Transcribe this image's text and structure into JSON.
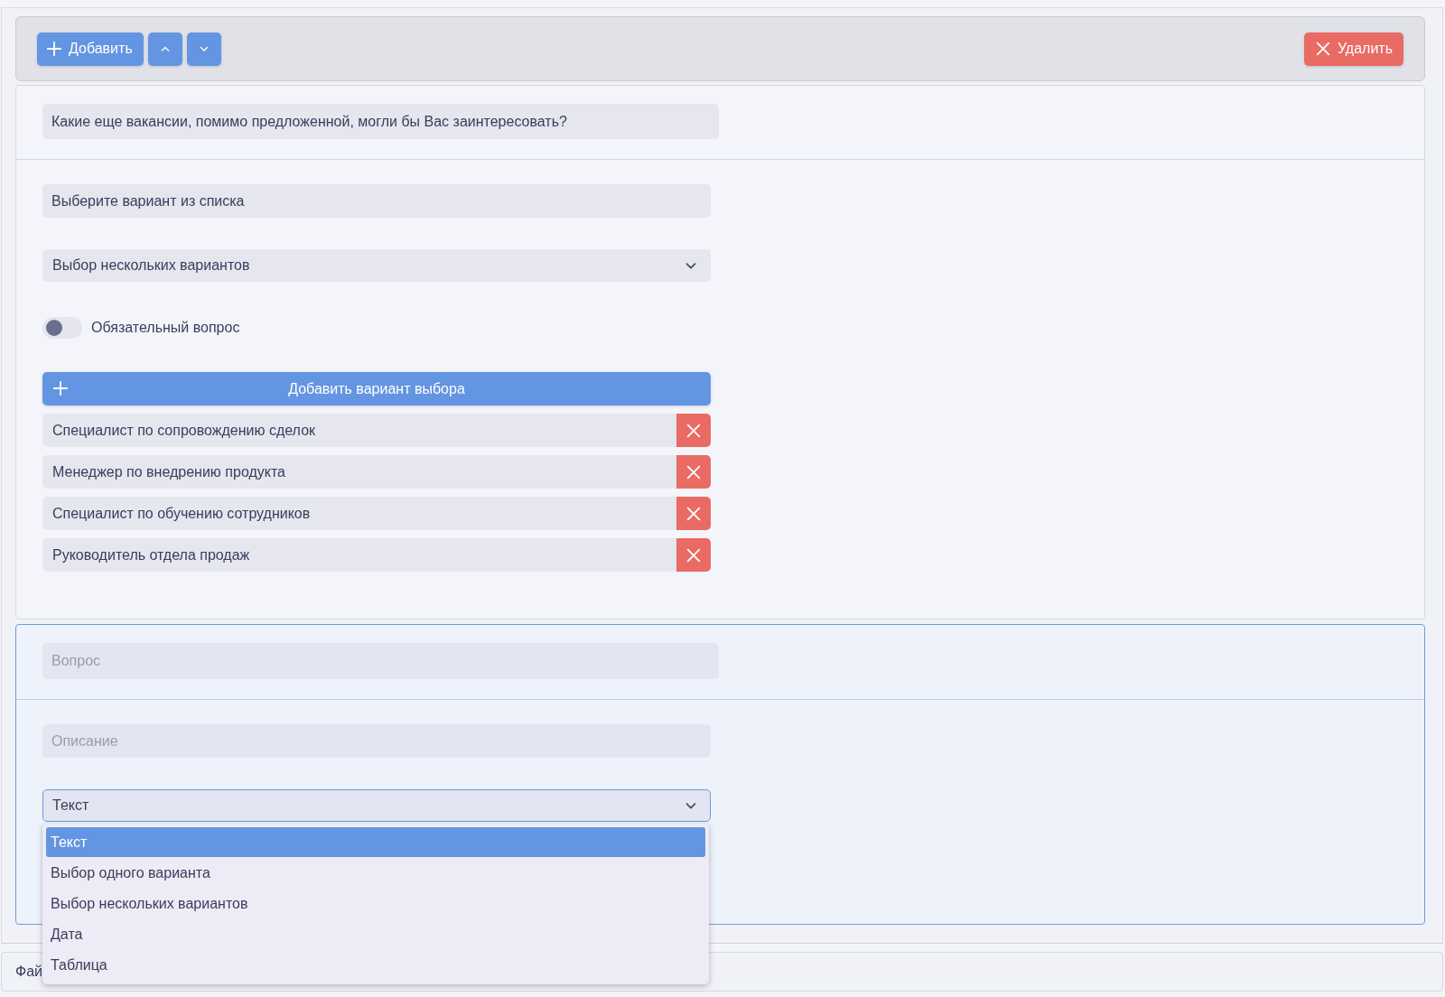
{
  "toolbar": {
    "add_button": "Добавить",
    "delete_button": "Удалить"
  },
  "questions": [
    {
      "selected": false,
      "question": {
        "value": "Какие еще вакансии, помимо предложенной, могли бы Вас заинтересовать?"
      },
      "description": {
        "value": "Выберите вариант из списка"
      },
      "type_select": {
        "value": "Выбор нескольких вариантов",
        "expanded": false
      },
      "required": {
        "label": "Обязательный вопрос",
        "on": false
      },
      "add_option_button": "Добавить вариант выбора",
      "options": [
        "Специалист по сопровождению сделок",
        "Менеджер по внедрению продукта",
        "Специалист по обучению сотрудников",
        "Руководитель отдела продаж"
      ]
    },
    {
      "selected": true,
      "question": {
        "placeholder": "Вопрос"
      },
      "description": {
        "placeholder": "Описание"
      },
      "type_select": {
        "value": "Текст",
        "expanded": true,
        "options": [
          {
            "label": "Текст",
            "selected": true
          },
          {
            "label": "Выбор одного варианта",
            "selected": false
          },
          {
            "label": "Выбор нескольких вариантов",
            "selected": false
          },
          {
            "label": "Дата",
            "selected": false
          },
          {
            "label": "Таблица",
            "selected": false
          }
        ]
      }
    }
  ],
  "bottom_panel": {
    "label": "Фай"
  }
}
